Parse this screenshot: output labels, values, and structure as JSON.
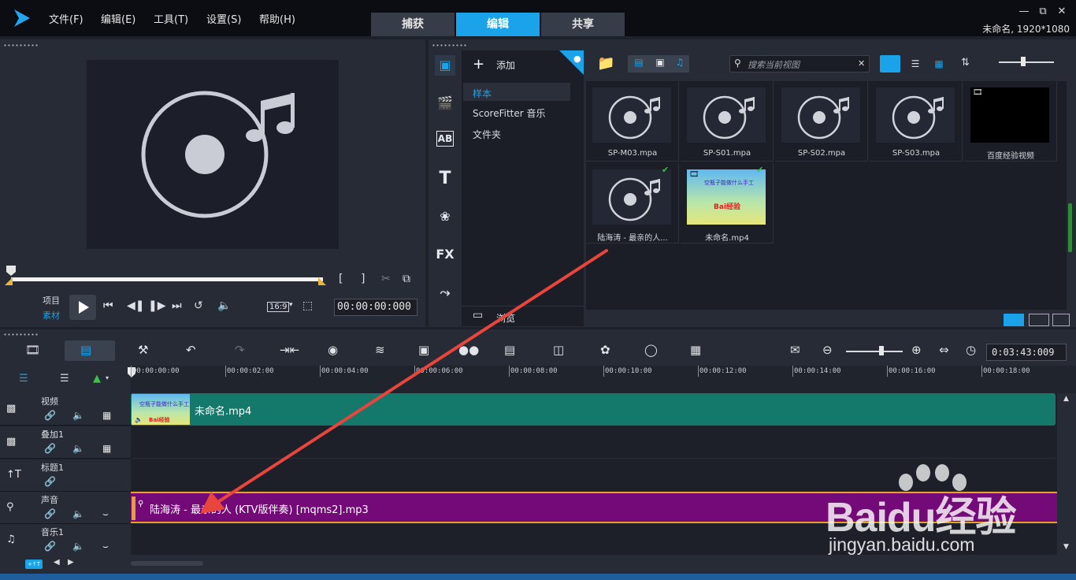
{
  "menu": {
    "file": "文件(F)",
    "edit": "编辑(E)",
    "tools": "工具(T)",
    "settings": "设置(S)",
    "help": "帮助(H)"
  },
  "tabs": {
    "capture": "捕获",
    "edit": "编辑",
    "share": "共享"
  },
  "project_info": "未命名, 1920*1080",
  "player": {
    "project_label": "项目",
    "clip_label": "素材",
    "aspect": "16:9",
    "timecode": "00:00:00:000"
  },
  "library": {
    "add_label": "添加",
    "folders": [
      "样本",
      "ScoreFitter 音乐",
      "文件夹"
    ],
    "browse_label": "浏览",
    "search_placeholder": "搜索当前视图",
    "items": [
      {
        "label": "SP-M03.mpa",
        "type": "audio",
        "checked": false
      },
      {
        "label": "SP-S01.mpa",
        "type": "audio",
        "checked": false
      },
      {
        "label": "SP-S02.mpa",
        "type": "audio",
        "checked": false
      },
      {
        "label": "SP-S03.mpa",
        "type": "audio",
        "checked": false
      },
      {
        "label": "百度经验视频",
        "type": "video",
        "checked": false
      },
      {
        "label": "陆海涛 - 最亲的人...",
        "type": "audio",
        "checked": true
      },
      {
        "label": "未命名.mp4",
        "type": "video",
        "checked": true
      }
    ],
    "side_icons": [
      "media-icon",
      "instant-project-icon",
      "transition-icon",
      "title-icon",
      "graphic-icon",
      "filter-icon",
      "path-icon"
    ]
  },
  "timeline": {
    "duration": "0:03:43:009",
    "ticks": [
      "00:00:00:00",
      "00:00:02:00",
      "00:00:04:00",
      "00:00:06:00",
      "00:00:08:00",
      "00:00:10:00",
      "00:00:12:00",
      "00:00:14:00",
      "00:00:16:00",
      "00:00:18:00"
    ],
    "tracks": [
      {
        "name": "视频"
      },
      {
        "name": "叠加1"
      },
      {
        "name": "标题1"
      },
      {
        "name": "声音"
      },
      {
        "name": "音乐1"
      }
    ],
    "video_clip_label": "未命名.mp4",
    "audio_clip_label": "陆海涛 - 最亲的人 (KTV版伴奏) [mqms2].mp3",
    "thumb_caption": "空瓶子能做什么手工",
    "thumb_logo": "Bai经验"
  },
  "watermark": {
    "brand": "Baidu经验",
    "url": "jingyan.baidu.com"
  },
  "colors": {
    "accent": "#1aa3e8",
    "video_clip": "#14796a",
    "audio_clip": "#730a77",
    "arrow": "#e8453c"
  }
}
